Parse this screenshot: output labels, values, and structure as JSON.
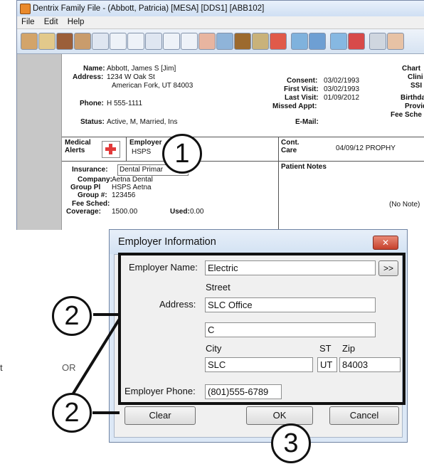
{
  "main_window": {
    "title": "Dentrix Family File - (Abbott, Patricia) [MESA] [DDS1] [ABB102]",
    "menu": [
      "File",
      "Edit",
      "Help"
    ],
    "patient": {
      "name_label": "Name:",
      "name": "Abbott, James S [Jim]",
      "address_label": "Address:",
      "address1": "1234 W Oak St",
      "address2": "American Fork, UT  84003",
      "phone_label": "Phone:",
      "phone": "H 555-1111",
      "status_label": "Status:",
      "status": "Active, M, Married, Ins",
      "consent_label": "Consent:",
      "consent": "03/02/1993",
      "first_visit_label": "First Visit:",
      "first_visit": "03/02/1993",
      "last_visit_label": "Last Visit:",
      "last_visit": "01/09/2012",
      "missed_label": "Missed Appt:",
      "email_label": "E-Mail:",
      "chart_label": "Chart",
      "clinic_label": "Clini",
      "ssn_label": "SSI",
      "birth_label": "Birthda",
      "provider_label": "Provid",
      "fee_label": "Fee Sche"
    },
    "medical_alerts_label": "Medical Alerts",
    "employer_label": "Employer",
    "employer_value": "HSPS",
    "cont_care_label": "Cont. Care",
    "cont_care_value": "04/09/12  PROPHY",
    "patient_notes_label": "Patient Notes",
    "no_note": "(No Note)",
    "insurance": {
      "insurance_label": "Insurance:",
      "insurance_value": "Dental Primar",
      "company_label": "Company:",
      "company": "Aetna Dental",
      "group_plan_label": "Group Pl",
      "group_plan": "HSPS Aetna",
      "group_num_label": "Group #:",
      "group_num": "123456",
      "fee_sched_label": "Fee Sched:",
      "coverage_label": "Coverage:",
      "coverage": "1500.00",
      "used_label": "Used:",
      "used": "0.00"
    }
  },
  "dialog": {
    "title": "Employer Information",
    "close_glyph": "✕",
    "employer_name_label": "Employer Name:",
    "employer_name_value": "Electric",
    "browse_label": ">>",
    "street_label": "Street",
    "address_label": "Address:",
    "street1_value": "SLC Office",
    "street2_value": "C",
    "city_label": "City",
    "st_label": "ST",
    "zip_label": "Zip",
    "city_value": "SLC",
    "st_value": "UT",
    "zip_value": "84003",
    "employer_phone_label": "Employer Phone:",
    "employer_phone_value": "(801)555-6789",
    "clear_label": "Clear",
    "ok_label": "OK",
    "cancel_label": "Cancel"
  },
  "callouts": [
    "1",
    "2",
    "2",
    "3"
  ],
  "side_text": {
    "or": "OR",
    "t": "t"
  },
  "colors": {
    "frame": "#111111",
    "accent_red": "#c6412c",
    "title_bg": "#dce8f6"
  }
}
